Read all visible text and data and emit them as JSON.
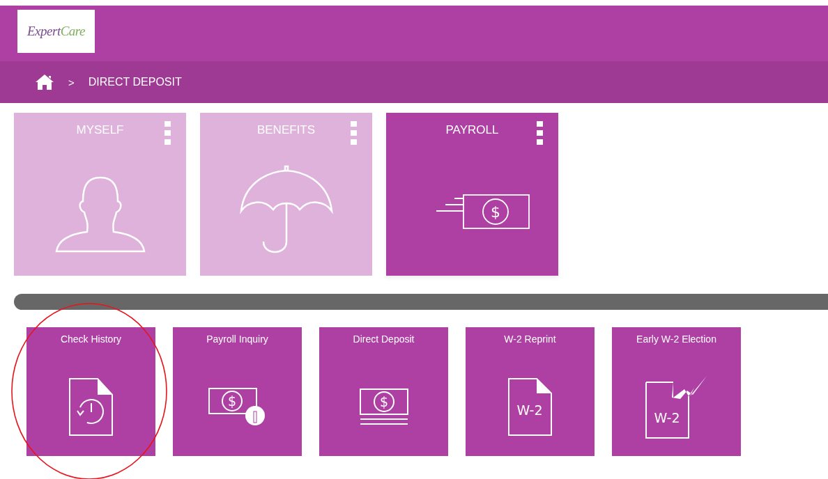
{
  "header": {
    "logo": {
      "part_1": "Expert",
      "part_2": "Care"
    }
  },
  "breadcrumb": {
    "separator": ">",
    "current": "DIRECT DEPOSIT"
  },
  "categories": [
    {
      "label": "MYSELF",
      "kind": "person",
      "selected": false
    },
    {
      "label": "BENEFITS",
      "kind": "umbrella",
      "selected": false
    },
    {
      "label": "PAYROLL",
      "kind": "money",
      "icon_text": "$",
      "selected": true
    }
  ],
  "tiles": [
    {
      "label": "Check History",
      "kind": "history",
      "highlighted": true
    },
    {
      "label": "Payroll Inquiry",
      "kind": "inquiry",
      "icon_text": "$",
      "highlighted": false
    },
    {
      "label": "Direct Deposit",
      "kind": "deposit",
      "icon_text": "$",
      "highlighted": false
    },
    {
      "label": "W-2 Reprint",
      "kind": "w2",
      "icon_text": "W-2",
      "highlighted": false
    },
    {
      "label": "Early W-2 Election",
      "kind": "w2early",
      "icon_text": "W-2",
      "highlighted": false
    }
  ]
}
